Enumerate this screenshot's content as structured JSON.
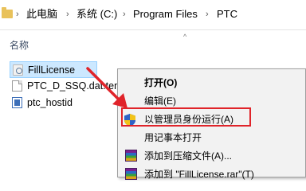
{
  "address_bar": {
    "crumbs": [
      "此电脑",
      "系统 (C:)",
      "Program Files",
      "PTC"
    ],
    "separator": "›"
  },
  "file_list": {
    "column_header": "名称",
    "files": [
      {
        "name": "FillLicense",
        "icon": "license-executable-icon",
        "selected": true
      },
      {
        "name": "PTC_D_SSQ.dat.tem",
        "icon": "document-icon",
        "selected": false
      },
      {
        "name": "ptc_hostid",
        "icon": "hostid-executable-icon",
        "selected": false
      }
    ]
  },
  "context_menu": {
    "items": [
      {
        "label": "打开(O)",
        "bold": true,
        "icon": null
      },
      {
        "label": "编辑(E)",
        "bold": false,
        "icon": null
      },
      {
        "label": "以管理员身份运行(A)",
        "bold": false,
        "icon": "uac-shield-icon"
      },
      {
        "label": "用记事本打开",
        "bold": false,
        "icon": null
      },
      {
        "label": "添加到压缩文件(A)...",
        "bold": false,
        "icon": "winrar-icon"
      },
      {
        "label": "添加到 \"FillLicense.rar\"(T)",
        "bold": false,
        "icon": "winrar-icon"
      }
    ]
  },
  "colors": {
    "selection_fill": "#cce8ff",
    "highlight_box": "#e0242a",
    "arrow": "#e0242a",
    "menu_background": "#f2f2f2"
  }
}
